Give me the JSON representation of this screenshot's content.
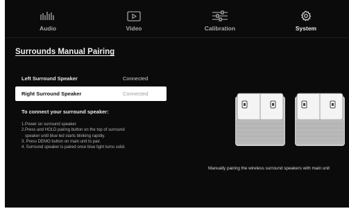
{
  "nav": {
    "tabs": [
      {
        "label": "Audio",
        "icon": "equalizer-bars-icon",
        "active": false
      },
      {
        "label": "Video",
        "icon": "play-screen-icon",
        "active": false
      },
      {
        "label": "Calibration",
        "icon": "sliders-icon",
        "active": false
      },
      {
        "label": "System",
        "icon": "gear-icon",
        "active": true
      }
    ]
  },
  "page": {
    "title": "Surrounds Manual Pairing"
  },
  "speakers_list": [
    {
      "name": "Left Surround Speaker",
      "status": "Connected",
      "selected": false
    },
    {
      "name": "Right Surround Speaker",
      "status": "Connected",
      "selected": true
    }
  ],
  "instructions": {
    "title": "To connect your surround speaker:",
    "lines": [
      "1.Power on surround speaker",
      "2.Press and HOLD pairing button on the top of surround",
      "speaker until blue led starts blinking rapidly.",
      "3. Press DEMO button on main unit to pair.",
      "4. Surround speaker is paired once blue light turns solid."
    ]
  },
  "illustration": {
    "caption": "Manually pairing the wireless surround speakers with main unit",
    "icon": "surround-speakers-illustration"
  },
  "colors": {
    "background": "#0b0b0b",
    "selected_row": "#ffffff",
    "text_primary": "#f0f0f0",
    "text_muted": "#b5b5b5"
  }
}
